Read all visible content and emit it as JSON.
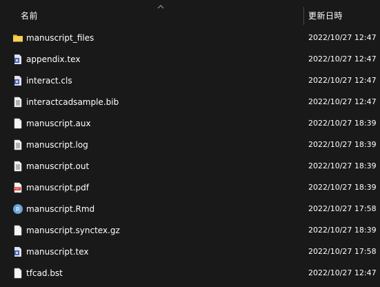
{
  "header": {
    "name_label": "名前",
    "date_label": "更新日時"
  },
  "files": [
    {
      "name": "manuscript_files",
      "date": "2022/10/27 12:47",
      "icon": "folder-icon"
    },
    {
      "name": "appendix.tex",
      "date": "2022/10/27 12:47",
      "icon": "tex-file-icon"
    },
    {
      "name": "interact.cls",
      "date": "2022/10/27 12:47",
      "icon": "tex-file-icon"
    },
    {
      "name": "interactcadsample.bib",
      "date": "2022/10/27 12:47",
      "icon": "text-file-icon"
    },
    {
      "name": "manuscript.aux",
      "date": "2022/10/27 18:39",
      "icon": "blank-file-icon"
    },
    {
      "name": "manuscript.log",
      "date": "2022/10/27 18:39",
      "icon": "text-file-icon"
    },
    {
      "name": "manuscript.out",
      "date": "2022/10/27 18:39",
      "icon": "text-file-icon"
    },
    {
      "name": "manuscript.pdf",
      "date": "2022/10/27 18:39",
      "icon": "pdf-file-icon"
    },
    {
      "name": "manuscript.Rmd",
      "date": "2022/10/27 17:58",
      "icon": "r-file-icon"
    },
    {
      "name": "manuscript.synctex.gz",
      "date": "2022/10/27 18:39",
      "icon": "blank-file-icon"
    },
    {
      "name": "manuscript.tex",
      "date": "2022/10/27 17:58",
      "icon": "tex-file-icon"
    },
    {
      "name": "tfcad.bst",
      "date": "2022/10/27 12:47",
      "icon": "blank-file-icon"
    }
  ],
  "colors": {
    "background": "#191919",
    "folder": "#f4c542",
    "pdf": "#d9302c",
    "r_icon": "#6aa5d9",
    "tex_icon": "#4a5fb5"
  }
}
